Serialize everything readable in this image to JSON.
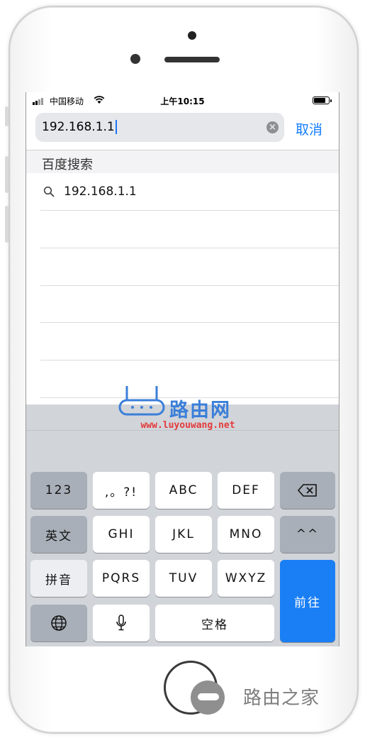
{
  "status_bar": {
    "carrier": "中国移动",
    "time": "上午10:15"
  },
  "search": {
    "url_value": "192.168.1.1",
    "cancel_label": "取消"
  },
  "suggestions": {
    "section_title": "百度搜索",
    "items": [
      {
        "text": "192.168.1.1",
        "icon": "search-icon"
      }
    ]
  },
  "watermark": {
    "name": "路由网",
    "url": "www.luyouwang.net"
  },
  "keyboard": {
    "row1": [
      "123",
      ",。?!",
      "ABC",
      "DEF"
    ],
    "row2": [
      "英文",
      "GHI",
      "JKL",
      "MNO",
      "^^"
    ],
    "row3": [
      "拼音",
      "PQRS",
      "TUV",
      "WXYZ"
    ],
    "row4": {
      "space": "空格"
    },
    "go": "前往",
    "icons": [
      "backspace-icon",
      "globe-icon",
      "microphone-icon"
    ]
  },
  "brand": {
    "name": "路由之家"
  },
  "colors": {
    "accent": "#147efb",
    "go_key": "#1a7ff5",
    "keyboard_bg": "#d1d4d9"
  }
}
